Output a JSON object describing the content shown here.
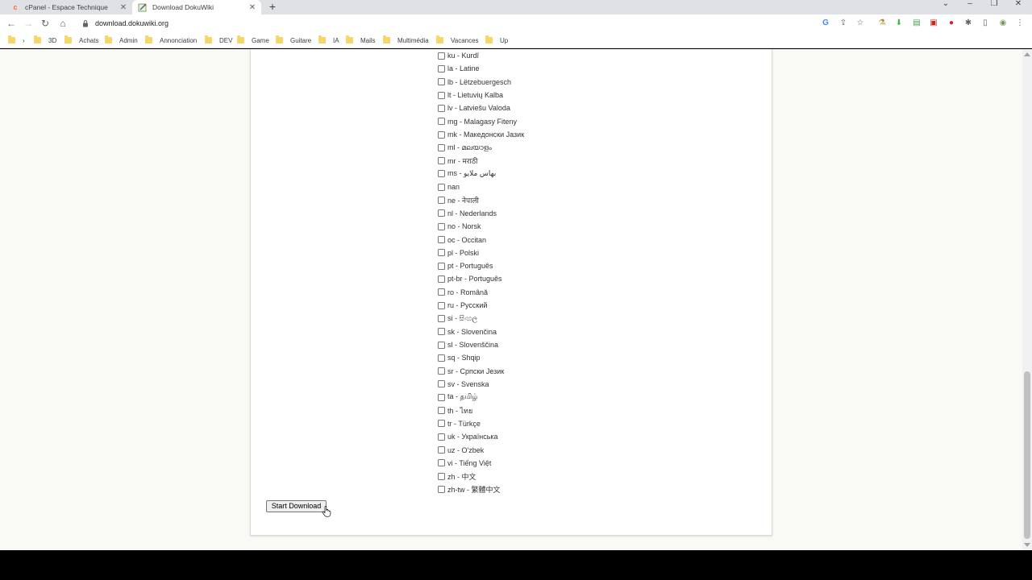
{
  "browser": {
    "tabs": [
      {
        "title": "cPanel - Espace Technique",
        "favicon": "cpanel-icon",
        "active": false
      },
      {
        "title": "Download DokuWiki",
        "favicon": "dokuwiki-icon",
        "active": true
      }
    ],
    "new_tab": "+",
    "url": "download.dokuwiki.org",
    "bookmarks": [
      "›",
      "3D",
      "Achats",
      "Admin",
      "Annonciation",
      "DEV",
      "Game",
      "Guitare",
      "IA",
      "Mails",
      "Multimédia",
      "Vacances",
      "Up"
    ]
  },
  "languages": [
    "ku - Kurdî",
    "la - Latine",
    "lb - Lëtzebuergesch",
    "lt - Lietuvių Kalba",
    "lv - Latviešu Valoda",
    "mg - Malagasy Fiteny",
    "mk - Македонски Јазик",
    "ml - മലയാളം",
    "mr - मराठी",
    "ms - بهاس ملايو",
    "nan",
    "ne - नेपाली",
    "nl - Nederlands",
    "no - Norsk",
    "oc - Occitan",
    "pl - Polski",
    "pt - Português",
    "pt-br - Português",
    "ro - Română",
    "ru - Русский",
    "si - සිංහල",
    "sk - Slovenčina",
    "sl - Slovenščina",
    "sq - Shqip",
    "sr - Српски Језик",
    "sv - Svenska",
    "ta - தமிழ்",
    "th - ไทย",
    "tr - Türkçe",
    "uk - Українська",
    "uz - O'zbek",
    "vi - Tiếng Việt",
    "zh - 中文",
    "zh-tw - 繁體中文"
  ],
  "download_button": "Start Download",
  "colors": {
    "folder": "#f4d768",
    "page_bg": "#f9f9f5",
    "tabstrip": "#dfe1e5"
  }
}
